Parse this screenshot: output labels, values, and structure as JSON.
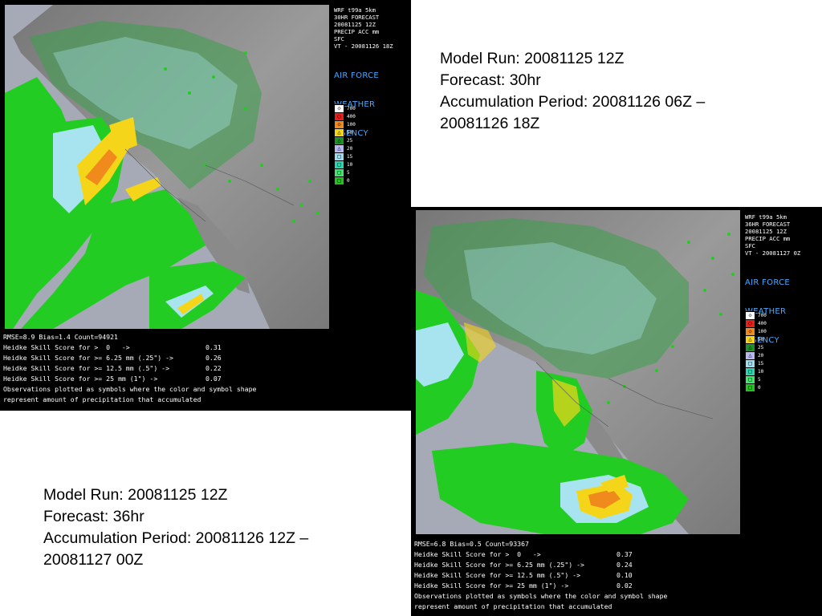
{
  "caption_top": {
    "model_run": "Model Run: 20081125 12Z",
    "forecast": "Forecast: 30hr",
    "accum_line1": "Accumulation Period: 20081126 06Z –",
    "accum_line2": "20081126 18Z"
  },
  "caption_bottom": {
    "model_run": "Model Run: 20081125 12Z",
    "forecast": "Forecast: 36hr",
    "accum_line1": "Accumulation Period: 20081126 12Z –",
    "accum_line2": "20081127 00Z"
  },
  "panel_top": {
    "header": [
      "WRF t99a 5km",
      "30HR FORECAST",
      "20081125 12Z",
      "PRECIP ACC mm",
      "SFC",
      "VT - 20081126 18Z"
    ],
    "agency": [
      "AIR FORCE",
      "WEATHER",
      "AGENCY"
    ],
    "stats": {
      "summary": "RMSE=8.9 Bias=1.4 Count=94921",
      "heidke": [
        {
          "label": "Heidke Skill Score for >  0   ->",
          "value": "0.31"
        },
        {
          "label": "Heidke Skill Score for >= 6.25 mm (.25\") ->",
          "value": "0.26"
        },
        {
          "label": "Heidke Skill Score for >= 12.5 mm (.5\") ->",
          "value": "0.22"
        },
        {
          "label": "Heidke Skill Score for >= 25 mm (1\") ->",
          "value": "0.07"
        }
      ],
      "note1": "Observations plotted as symbols where the color and symbol shape",
      "note2": "represent amount of precipitation that accumulated"
    }
  },
  "panel_bottom": {
    "header": [
      "WRF t99a 5km",
      "36HR FORECAST",
      "20081125 12Z",
      "PRECIP ACC mm",
      "SFC",
      "VT - 20081127 0Z"
    ],
    "agency": [
      "AIR FORCE",
      "WEATHER",
      "AGENCY"
    ],
    "stats": {
      "summary": "RMSE=6.8 Bias=0.5 Count=93367",
      "heidke": [
        {
          "label": "Heidke Skill Score for >  0   ->",
          "value": "0.37"
        },
        {
          "label": "Heidke Skill Score for >= 6.25 mm (.25\") ->",
          "value": "0.24"
        },
        {
          "label": "Heidke Skill Score for >= 12.5 mm (.5\") ->",
          "value": "0.10"
        },
        {
          "label": "Heidke Skill Score for >= 25 mm (1\") ->",
          "value": "0.02"
        }
      ],
      "note1": "Observations plotted as symbols where the color and symbol shape",
      "note2": "represent amount of precipitation that accumulated"
    }
  },
  "legend": [
    {
      "value": "700",
      "color": "#ffffff",
      "symbol": "◇"
    },
    {
      "value": "400",
      "color": "#e8201a",
      "symbol": "○"
    },
    {
      "value": "100",
      "color": "#f08a1c",
      "symbol": "◇"
    },
    {
      "value": "50",
      "color": "#f5d51a",
      "symbol": "△"
    },
    {
      "value": "25",
      "color": "#1f8f2a",
      "symbol": "△"
    },
    {
      "value": "20",
      "color": "#b7b8f0",
      "symbol": "△"
    },
    {
      "value": "15",
      "color": "#9fdcf0",
      "symbol": "□"
    },
    {
      "value": "10",
      "color": "#2ad8b0",
      "symbol": "□"
    },
    {
      "value": "5",
      "color": "#3de86a",
      "symbol": "□"
    },
    {
      "value": "0",
      "color": "#22c41c",
      "symbol": "□"
    }
  ],
  "colors": {
    "land": "#8d8d8d",
    "ocean": "#a6aab6",
    "precip_light": "#22cc22",
    "precip_mid": "#2ad8b0",
    "precip_cyan": "#a8e4f0",
    "precip_lavender": "#b7b8f0",
    "precip_yellow": "#f5d51a",
    "precip_orange": "#f08a1c",
    "agency_text": "#4aa8ff"
  }
}
